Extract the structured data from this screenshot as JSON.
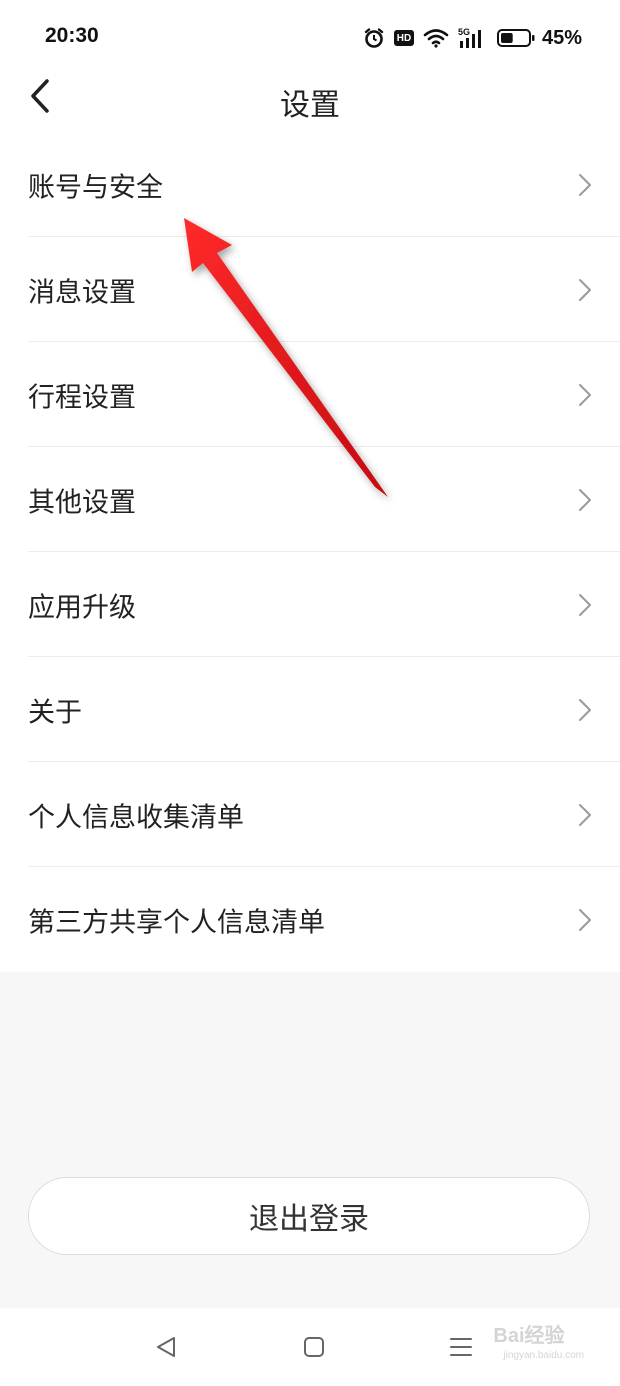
{
  "status_bar": {
    "time": "20:30",
    "battery_percent": "45%",
    "battery_level": 0.45,
    "network": "5G",
    "hd_label": "HD",
    "icons": [
      "alarm-icon",
      "hd-icon",
      "wifi-icon",
      "signal-5g-icon",
      "battery-icon"
    ]
  },
  "header": {
    "title": "设置",
    "back_icon": "chevron-left-icon"
  },
  "settings": {
    "items": [
      {
        "label": "账号与安全"
      },
      {
        "label": "消息设置"
      },
      {
        "label": "行程设置"
      },
      {
        "label": "其他设置"
      },
      {
        "label": "应用升级"
      },
      {
        "label": "关于"
      },
      {
        "label": "个人信息收集清单"
      },
      {
        "label": "第三方共享个人信息清单"
      }
    ],
    "chevron_icon": "chevron-right-icon"
  },
  "logout": {
    "label": "退出登录"
  },
  "nav_bar": {
    "buttons": [
      "back-triangle-icon",
      "home-square-icon",
      "menu-lines-icon"
    ]
  },
  "watermark": {
    "text": "Bai经验",
    "subtext": "jingyan.baidu.com"
  },
  "colors": {
    "background": "#f7f7f7",
    "surface": "#ffffff",
    "text_primary": "#222222",
    "divider": "#ececec",
    "annotation_arrow": "#e8141c"
  }
}
